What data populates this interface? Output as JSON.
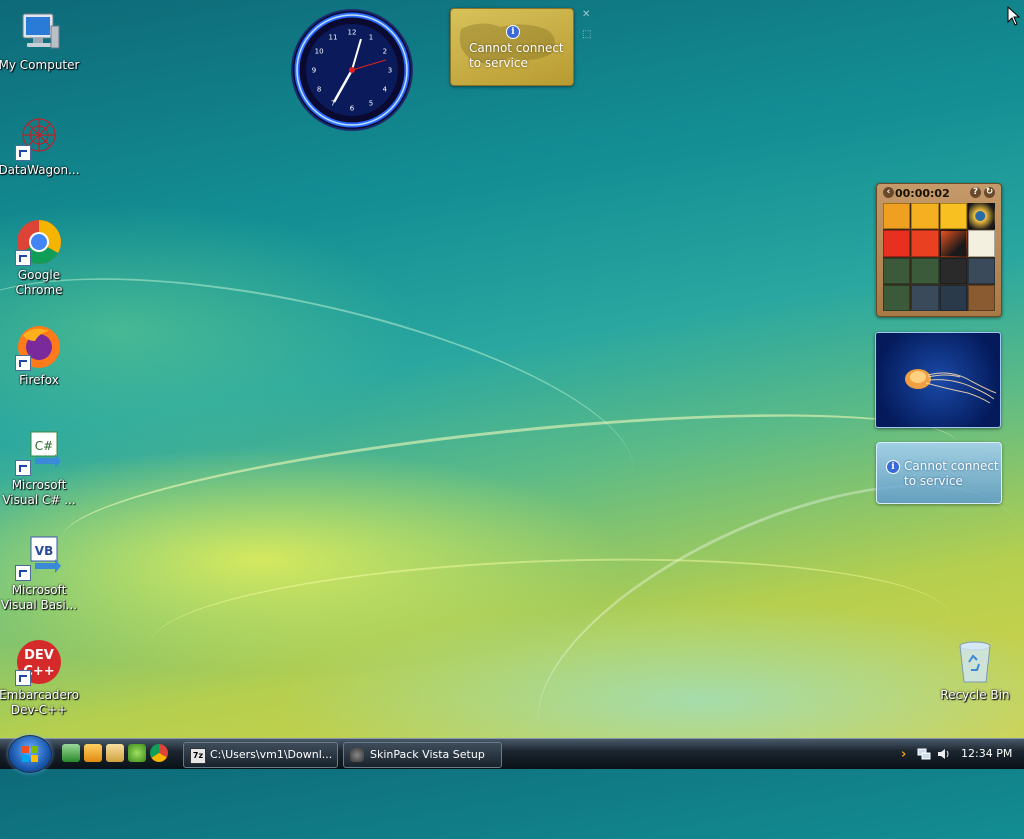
{
  "desktop": {
    "icons": [
      {
        "label": "My Computer"
      },
      {
        "label": "DataWagon..."
      },
      {
        "label": "Google Chrome"
      },
      {
        "label": "Firefox"
      },
      {
        "label": "Microsoft Visual C# ..."
      },
      {
        "label": "Microsoft Visual Basi..."
      },
      {
        "label": "Embarcadero Dev-C++"
      },
      {
        "label": "Recycle Bin"
      }
    ]
  },
  "gadgets": {
    "clock": {
      "numbers": [
        "12",
        "1",
        "2",
        "3",
        "4",
        "5",
        "6",
        "7",
        "8",
        "9",
        "10",
        "11"
      ]
    },
    "weather": {
      "message": "Cannot connect to service"
    },
    "puzzle": {
      "timer": "00:00:02"
    },
    "feed": {
      "message": "Cannot connect to service"
    }
  },
  "taskbar": {
    "tasks": [
      {
        "label": "C:\\Users\\vm1\\Downl..."
      },
      {
        "label": "SkinPack Vista Setup"
      }
    ],
    "clock": "12:34 PM"
  }
}
